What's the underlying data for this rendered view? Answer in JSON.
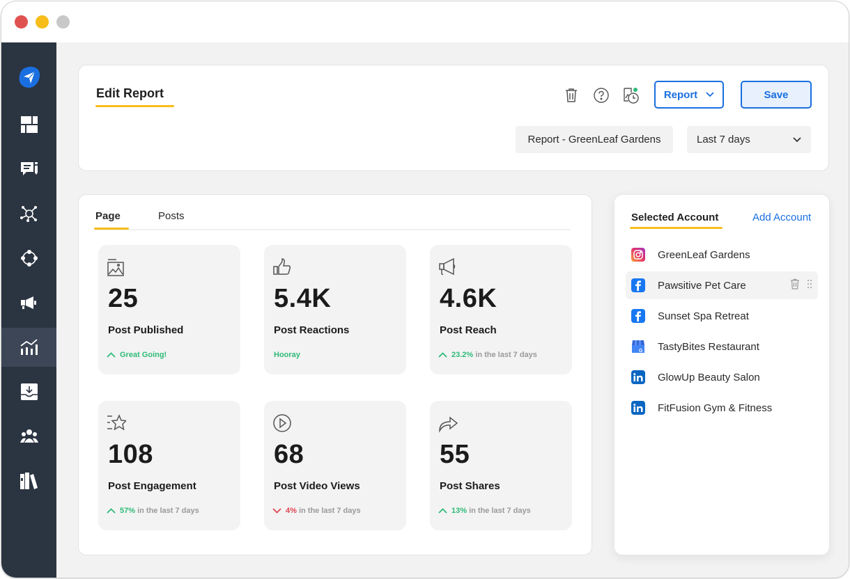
{
  "window": {
    "controls": [
      "close",
      "minimize",
      "zoom"
    ]
  },
  "sidebar": {
    "items": [
      {
        "name": "send-logo",
        "icon": "paper-plane-icon"
      },
      {
        "name": "dashboard",
        "icon": "dashboard-grid-icon"
      },
      {
        "name": "messages",
        "icon": "chat-icon"
      },
      {
        "name": "network",
        "icon": "network-hub-icon"
      },
      {
        "name": "workflow",
        "icon": "circle-nodes-icon"
      },
      {
        "name": "campaigns",
        "icon": "megaphone-icon"
      },
      {
        "name": "analytics",
        "icon": "analytics-chart-icon",
        "active": true
      },
      {
        "name": "inbox",
        "icon": "inbox-download-icon"
      },
      {
        "name": "team",
        "icon": "users-icon"
      },
      {
        "name": "library",
        "icon": "books-icon"
      }
    ]
  },
  "header": {
    "title": "Edit Report",
    "report_button": "Report",
    "save_button": "Save",
    "report_name": "Report - GreenLeaf Gardens",
    "date_range": "Last 7 days"
  },
  "tabs": [
    {
      "label": "Page",
      "active": true
    },
    {
      "label": "Posts",
      "active": false
    }
  ],
  "stats": [
    {
      "icon": "image-gallery-icon",
      "value": "25",
      "label": "Post Published",
      "trend": "up",
      "pct": "",
      "message": "Great Going!",
      "suffix": ""
    },
    {
      "icon": "thumbs-up-icon",
      "value": "5.4K",
      "label": "Post Reactions",
      "trend": "none",
      "pct": "",
      "message": "Hooray",
      "suffix": ""
    },
    {
      "icon": "megaphone-icon",
      "value": "4.6K",
      "label": "Post Reach",
      "trend": "up",
      "pct": "23.2%",
      "message": "",
      "suffix": "in the last 7 days"
    },
    {
      "icon": "star-list-icon",
      "value": "108",
      "label": "Post Engagement",
      "trend": "up",
      "pct": "57%",
      "message": "",
      "suffix": "in the last 7 days"
    },
    {
      "icon": "play-circle-icon",
      "value": "68",
      "label": "Post Video Views",
      "trend": "down",
      "pct": "4%",
      "message": "",
      "suffix": "in the last 7 days"
    },
    {
      "icon": "share-arrow-icon",
      "value": "55",
      "label": "Post Shares",
      "trend": "up",
      "pct": "13%",
      "message": "",
      "suffix": "in the last 7 days"
    }
  ],
  "accounts": {
    "heading": "Selected Account",
    "add_label": "Add Account",
    "items": [
      {
        "name": "GreenLeaf Gardens",
        "platform": "instagram"
      },
      {
        "name": "Pawsitive Pet Care",
        "platform": "facebook",
        "hovered": true
      },
      {
        "name": "Sunset Spa Retreat",
        "platform": "facebook"
      },
      {
        "name": "TastyBites Restaurant",
        "platform": "google-business"
      },
      {
        "name": "GlowUp Beauty Salon",
        "platform": "linkedin"
      },
      {
        "name": "FitFusion Gym & Fitness",
        "platform": "linkedin"
      }
    ]
  },
  "colors": {
    "accent": "#1a6fe0",
    "underline": "#f6bd1b",
    "up": "#2ebb78",
    "down": "#e0454f",
    "sidebar": "#2b3441"
  }
}
